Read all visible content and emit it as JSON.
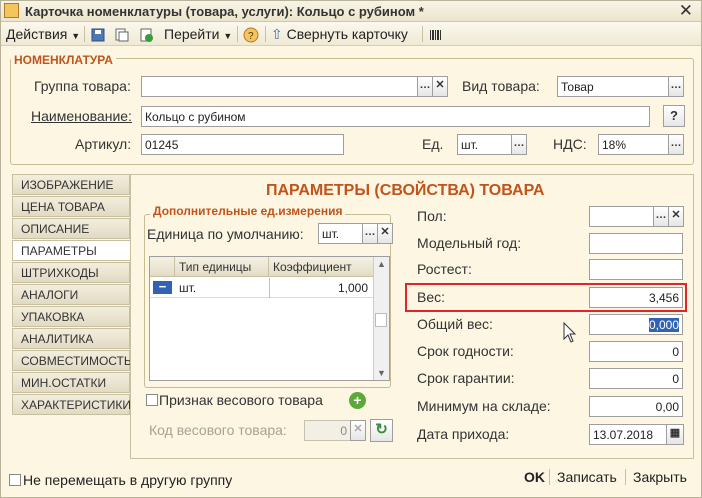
{
  "window": {
    "title": "Карточка номенклатуры (товара, услуги): Кольцо с рубином *"
  },
  "toolbar": {
    "actions": "Действия",
    "goto": "Перейти",
    "collapse": "Свернуть карточку"
  },
  "group": {
    "title": "НОМЕНКЛАТУРА",
    "group_label": "Группа товара:",
    "group_value": "",
    "kind_label": "Вид товара:",
    "kind_value": "Товар",
    "name_label": "Наименование:",
    "name_value": "Кольцо с рубином",
    "article_label": "Артикул:",
    "article_value": "01245",
    "unit_label": "Ед.",
    "unit_value": "шт.",
    "vat_label": "НДС:",
    "vat_value": "18%",
    "help": "?"
  },
  "tabs": [
    "ИЗОБРАЖЕНИЕ",
    "ЦЕНА ТОВАРА",
    "ОПИСАНИЕ",
    "ПАРАМЕТРЫ",
    "ШТРИХКОДЫ",
    "АНАЛОГИ",
    "УПАКОВКА",
    "АНАЛИТИКА",
    "СОВМЕСТИМОСТЬ",
    "МИН.ОСТАТКИ",
    "ХАРАКТЕРИСТИКИ"
  ],
  "params": {
    "title": "ПАРАМЕТРЫ (СВОЙСТВА) ТОВАРА",
    "units_title": "Дополнительные ед.измерения",
    "default_unit_label": "Единица по умолчанию:",
    "default_unit_value": "шт.",
    "grid_headers": [
      "Тип единицы",
      "Коэффициент"
    ],
    "grid_row": {
      "unit": "шт.",
      "coef": "1,000"
    },
    "weight_flag_label": "Признак весового товара",
    "weight_code_label": "Код весового товара:",
    "weight_code_value": "0",
    "gender_label": "Пол:",
    "gender_value": "",
    "model_year_label": "Модельный год:",
    "model_year_value": "",
    "rostest_label": "Ростест:",
    "rostest_value": "",
    "weight_label": "Вес:",
    "weight_value": "3,456",
    "total_weight_label": "Общий вес:",
    "total_weight_value": "0,000",
    "shelf_life_label": "Срок годности:",
    "shelf_life_value": "0",
    "warranty_label": "Срок гарантии:",
    "warranty_value": "0",
    "min_stock_label": "Минимум на складе:",
    "min_stock_value": "0,00",
    "arrival_label": "Дата прихода:",
    "arrival_value": "13.07.2018"
  },
  "footer": {
    "no_move_label": "Не перемещать в другую группу",
    "ok": "OK",
    "save": "Записать",
    "close": "Закрыть"
  },
  "colors": {
    "accent": "#c0541b",
    "highlight": "#e0252b",
    "selection": "#3162b4"
  }
}
